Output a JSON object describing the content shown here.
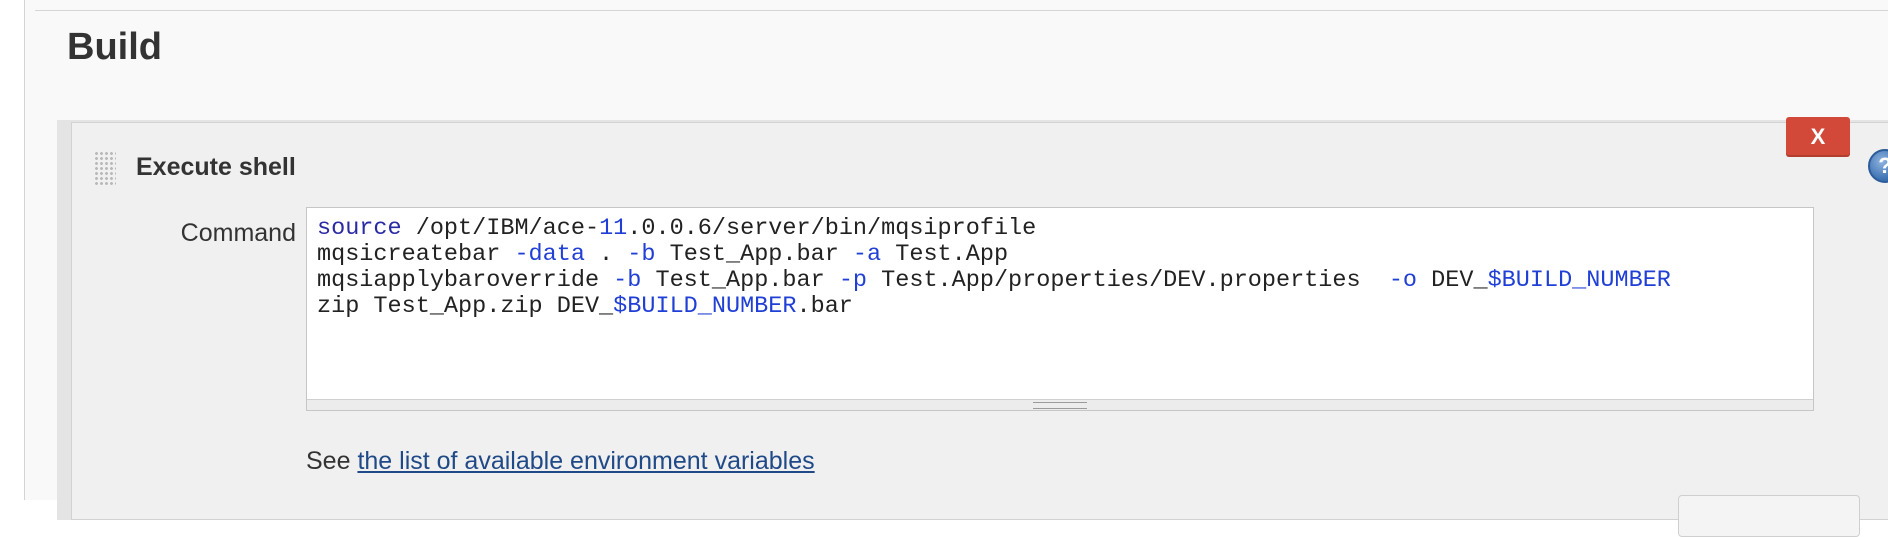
{
  "section": {
    "title": "Build"
  },
  "step": {
    "title": "Execute shell",
    "delete_label": "X",
    "help_label": "?"
  },
  "command": {
    "label": "Command",
    "lines": [
      [
        {
          "t": "source",
          "c": "kw"
        },
        {
          "t": " /opt/IBM/ace-",
          "c": ""
        },
        {
          "t": "11",
          "c": "var"
        },
        {
          "t": ".0.0.6/server/bin/mqsiprofile",
          "c": ""
        }
      ],
      [
        {
          "t": "mqsicreatebar ",
          "c": ""
        },
        {
          "t": "-data",
          "c": "var"
        },
        {
          "t": " . ",
          "c": ""
        },
        {
          "t": "-b",
          "c": "var"
        },
        {
          "t": " Test_App.bar ",
          "c": ""
        },
        {
          "t": "-a",
          "c": "var"
        },
        {
          "t": " Test.App",
          "c": ""
        }
      ],
      [
        {
          "t": "mqsiapplybaroverride ",
          "c": ""
        },
        {
          "t": "-b",
          "c": "var"
        },
        {
          "t": " Test_App.bar ",
          "c": ""
        },
        {
          "t": "-p",
          "c": "var"
        },
        {
          "t": " Test.App/properties/DEV.properties  ",
          "c": ""
        },
        {
          "t": "-o",
          "c": "var"
        },
        {
          "t": " DEV_",
          "c": ""
        },
        {
          "t": "$BUILD_NUMBER",
          "c": "var"
        }
      ],
      [
        {
          "t": "zip Test_App.zip DEV_",
          "c": ""
        },
        {
          "t": "$BUILD_NUMBER",
          "c": "var"
        },
        {
          "t": ".bar",
          "c": ""
        }
      ]
    ]
  },
  "help": {
    "prefix": "See ",
    "link_text": "the list of available environment variables"
  },
  "colors": {
    "delete": "#d24939",
    "link": "#204a87",
    "code_keyword": "#1f3fd6"
  }
}
